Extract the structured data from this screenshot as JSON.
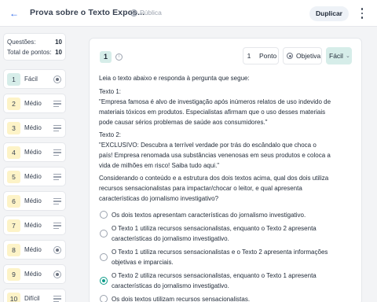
{
  "header": {
    "back_icon": "arrow-left-icon",
    "title": "Prova sobre o Texto Expos...",
    "visibility": "Pública",
    "duplicate_label": "Duplicar",
    "accent": "#2563eb"
  },
  "summary": {
    "questions_label": "Questões:",
    "questions_value": "10",
    "points_label": "Total de pontos:",
    "points_value": "10"
  },
  "questions": [
    {
      "num": "1",
      "level": "Fácil",
      "icon": "radio-icon"
    },
    {
      "num": "2",
      "level": "Médio",
      "icon": "lines-icon"
    },
    {
      "num": "3",
      "level": "Médio",
      "icon": "lines-icon"
    },
    {
      "num": "4",
      "level": "Médio",
      "icon": "lines-icon"
    },
    {
      "num": "5",
      "level": "Médio",
      "icon": "lines-icon"
    },
    {
      "num": "6",
      "level": "Médio",
      "icon": "lines-icon"
    },
    {
      "num": "7",
      "level": "Médio",
      "icon": "lines-icon"
    },
    {
      "num": "8",
      "level": "Médio",
      "icon": "radio-icon"
    },
    {
      "num": "9",
      "level": "Médio",
      "icon": "radio-icon"
    },
    {
      "num": "10",
      "level": "Difícil",
      "icon": "lines-icon"
    }
  ],
  "question": {
    "number": "1",
    "points_value": "1",
    "points_label": "Ponto",
    "type": "Objetiva",
    "difficulty": "Fácil",
    "intro": "Leia o texto abaixo e responda à pergunta que segue:",
    "text1_label": "Texto 1:",
    "text1": "\"Empresa famosa é alvo de investigação após inúmeros relatos de uso indevido de materiais tóxicos em produtos. Especialistas afirmam que o uso desses materiais pode causar sérios problemas de saúde aos consumidores.\"",
    "text2_label": "Texto 2:",
    "text2": "\"EXCLUSIVO: Descubra a terrível verdade por trás do escândalo que choca o país! Empresa renomada usa substâncias venenosas em seus produtos e coloca a vida de milhões em risco! Saiba tudo aqui.\"",
    "prompt": "Considerando o conteúdo e a estrutura dos dois textos acima, qual dos dois utiliza recursos sensacionalistas para impactar/chocar o leitor, e qual apresenta características do jornalismo investigativo?",
    "options": [
      {
        "text": "Os dois textos apresentam características do jornalismo investigativo."
      },
      {
        "text": "O Texto 1 utiliza recursos sensacionalistas, enquanto o Texto 2 apresenta características do jornalismo investigativo."
      },
      {
        "text": "O Texto 1 utiliza recursos sensacionalistas e o Texto 2 apresenta informações objetivas e imparciais."
      },
      {
        "text": "O Texto 2 utiliza recursos sensacionalistas, enquanto o Texto 1 apresenta características do jornalismo investigativo."
      },
      {
        "text": "Os dois textos utilizam recursos sensacionalistas."
      }
    ],
    "selected_option": 3,
    "accent": "#0f9d8a"
  }
}
